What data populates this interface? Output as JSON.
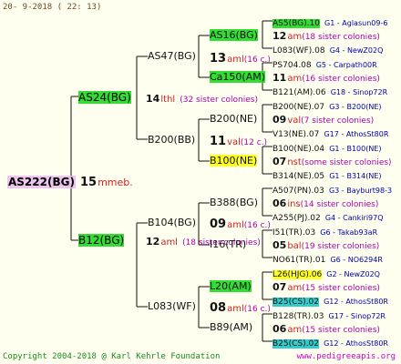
{
  "header": "20-  9-2018 (  22:  13)",
  "footer": {
    "copyright": "Copyright 2004-2018 @ Karl Kehrle Foundation",
    "url": "www.pedigreeapis.org"
  },
  "root": {
    "name": "AS222(BG)",
    "num": "15",
    "note": "mmeb."
  },
  "gen1": [
    {
      "name": "AS24(BG)",
      "num": "14",
      "note": "lthl",
      "colonies": "(32 sister colonies)"
    },
    {
      "name": "B12(BG)",
      "num": "12",
      "note": "aml",
      "colonies": "(18 sister colonies)"
    }
  ],
  "gen2": [
    {
      "name": "AS47(BG)"
    },
    {
      "name": "B200(BB)"
    },
    {
      "name": "B104(BG)"
    },
    {
      "name": "L083(WF)"
    }
  ],
  "gen3": [
    {
      "name": "AS16(BG)",
      "num": "13",
      "note": "aml",
      "sub": "(16 c.)"
    },
    {
      "name": "Ca150(AM)",
      "num": "",
      "note": "",
      "sub": ""
    },
    {
      "name": "B200(NE)",
      "num": "11",
      "note": "val",
      "sub": "(12 c.)"
    },
    {
      "name": "B100(NE)",
      "num": "",
      "note": "",
      "sub": ""
    },
    {
      "name": "B388(BG)",
      "num": "09",
      "note": "aml",
      "sub": "(16 c.)"
    },
    {
      "name": "I16(TR)",
      "num": "",
      "note": "",
      "sub": ""
    },
    {
      "name": "L20(AM)",
      "num": "08",
      "note": "aml",
      "sub": "(16 c.)"
    },
    {
      "name": "B89(AM)",
      "num": "",
      "note": "",
      "sub": ""
    }
  ],
  "gen4": [
    {
      "a": "AS5(BG).10",
      "ainfo": "G1 - Aglasun09-6",
      "num": "12",
      "note": "am",
      "sub": "(18 sister colonies)",
      "b": "L083(WF).08",
      "binfo": "G4 - NewZ02Q"
    },
    {
      "a": "PS704.08",
      "ainfo": "G5 - Carpath00R",
      "num": "11",
      "note": "am",
      "sub": "(16 sister colonies)",
      "b": "B121(AM).06",
      "binfo": "G18 - Sinop72R"
    },
    {
      "a": "B200(NE).07",
      "ainfo": "G3 - B200(NE)",
      "num": "09",
      "note": "val",
      "sub": "(7 sister colonies)",
      "b": "V13(NE).07",
      "binfo": "G17 - AthosSt80R"
    },
    {
      "a": "B100(NE).04",
      "ainfo": "G1 - B100(NE)",
      "num": "07",
      "note": "nst",
      "sub": "(some sister colonies)",
      "b": "B314(NE).05",
      "binfo": "G1 - B314(NE)"
    },
    {
      "a": "A507(PN).03",
      "ainfo": "G3 - Bayburt98-3",
      "num": "06",
      "note": "ins",
      "sub": "(14 sister colonies)",
      "b": "A255(PJ).02",
      "binfo": "G4 - Cankiri97Q"
    },
    {
      "a": "I51(TR).03",
      "ainfo": "G6 - Takab93aR",
      "num": "05",
      "note": "bal",
      "sub": "(19 sister colonies)",
      "b": "NO61(TR).01",
      "binfo": "G6 - NO6294R"
    },
    {
      "a": "L26(HJG).06",
      "ainfo": "G2 - NewZ02Q",
      "num": "07",
      "note": "am",
      "sub": "(15 sister colonies)",
      "b": "B25(CS).02",
      "binfo": "G12 - AthosSt80R"
    },
    {
      "a": "B128(TR).03",
      "ainfo": "G17 - Sinop72R",
      "num": "06",
      "note": "am",
      "sub": "(15 sister colonies)",
      "b": "B25(CS).02",
      "binfo": "G12 - AthosSt80R"
    }
  ]
}
